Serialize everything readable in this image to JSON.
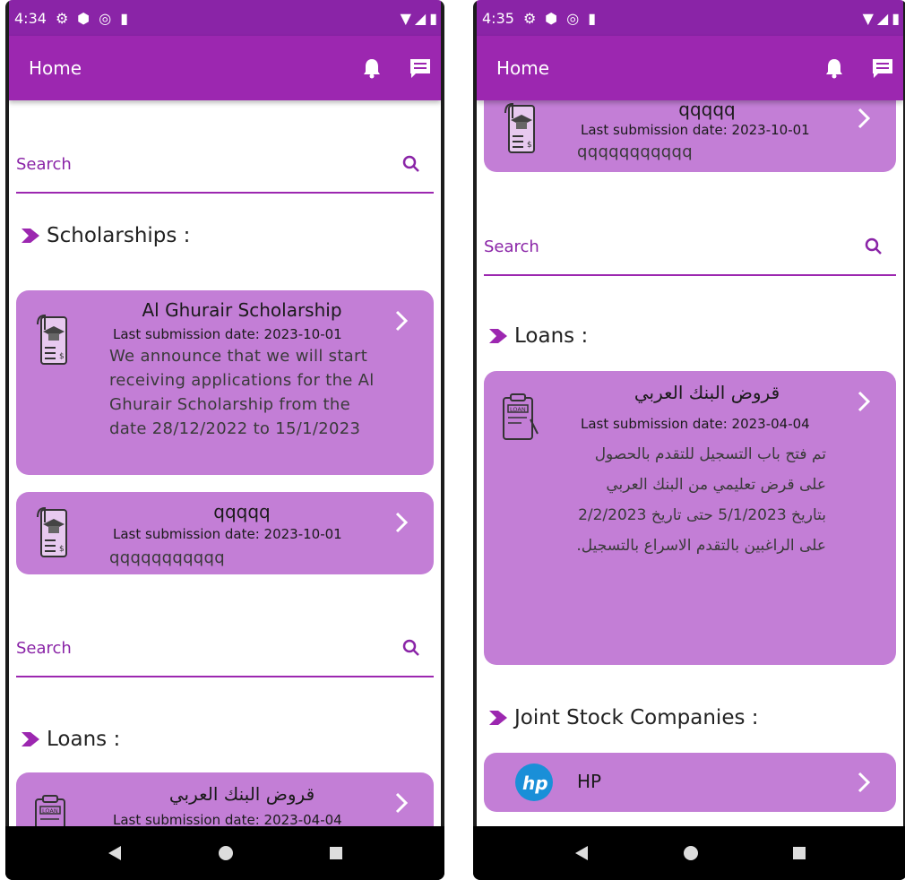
{
  "left": {
    "status": {
      "time": "4:34"
    },
    "appbar": {
      "title": "Home"
    },
    "search1": {
      "placeholder": "Search"
    },
    "scholarships": {
      "heading": "Scholarships :",
      "cards": [
        {
          "title": "Al Ghurair Scholarship",
          "date": "Last submission date: 2023-10-01",
          "desc": "We announce that we will start receiving applications for the Al Ghurair Scholarship from the date 28/12/2022 to 15/1/2023"
        },
        {
          "title": "qqqqq",
          "date": "Last submission date: 2023-10-01",
          "desc": "qqqqqqqqqqq"
        }
      ]
    },
    "search2": {
      "placeholder": "Search"
    },
    "loans": {
      "heading": "Loans :",
      "cards": [
        {
          "title": "قروض البنك العربي",
          "date": "Last submission date: 2023-04-04"
        }
      ]
    }
  },
  "right": {
    "status": {
      "time": "4:35"
    },
    "appbar": {
      "title": "Home"
    },
    "top_card": {
      "title": "qqqqq",
      "date": "Last submission date: 2023-10-01",
      "desc": "qqqqqqqqqqq"
    },
    "search": {
      "placeholder": "Search"
    },
    "loans": {
      "heading": "Loans :",
      "cards": [
        {
          "title": "قروض البنك العربي",
          "date": "Last submission date: 2023-04-04",
          "desc": "تم فتح باب التسجيل للتقدم بالحصول على قرض تعليمي من البنك العربي بتاريخ 5/1/2023 حتى تاريخ 2/2/2023 على الراغبين بالتقدم الاسراع بالتسجيل."
        }
      ]
    },
    "companies": {
      "heading": "Joint Stock Companies :",
      "items": [
        {
          "name": "HP",
          "logo": "hp-logo"
        }
      ]
    }
  },
  "colors": {
    "appbar": "#9c27b0",
    "statusbar": "#8a24a7",
    "card": "#c37ed6",
    "accent": "#8a24a7"
  }
}
